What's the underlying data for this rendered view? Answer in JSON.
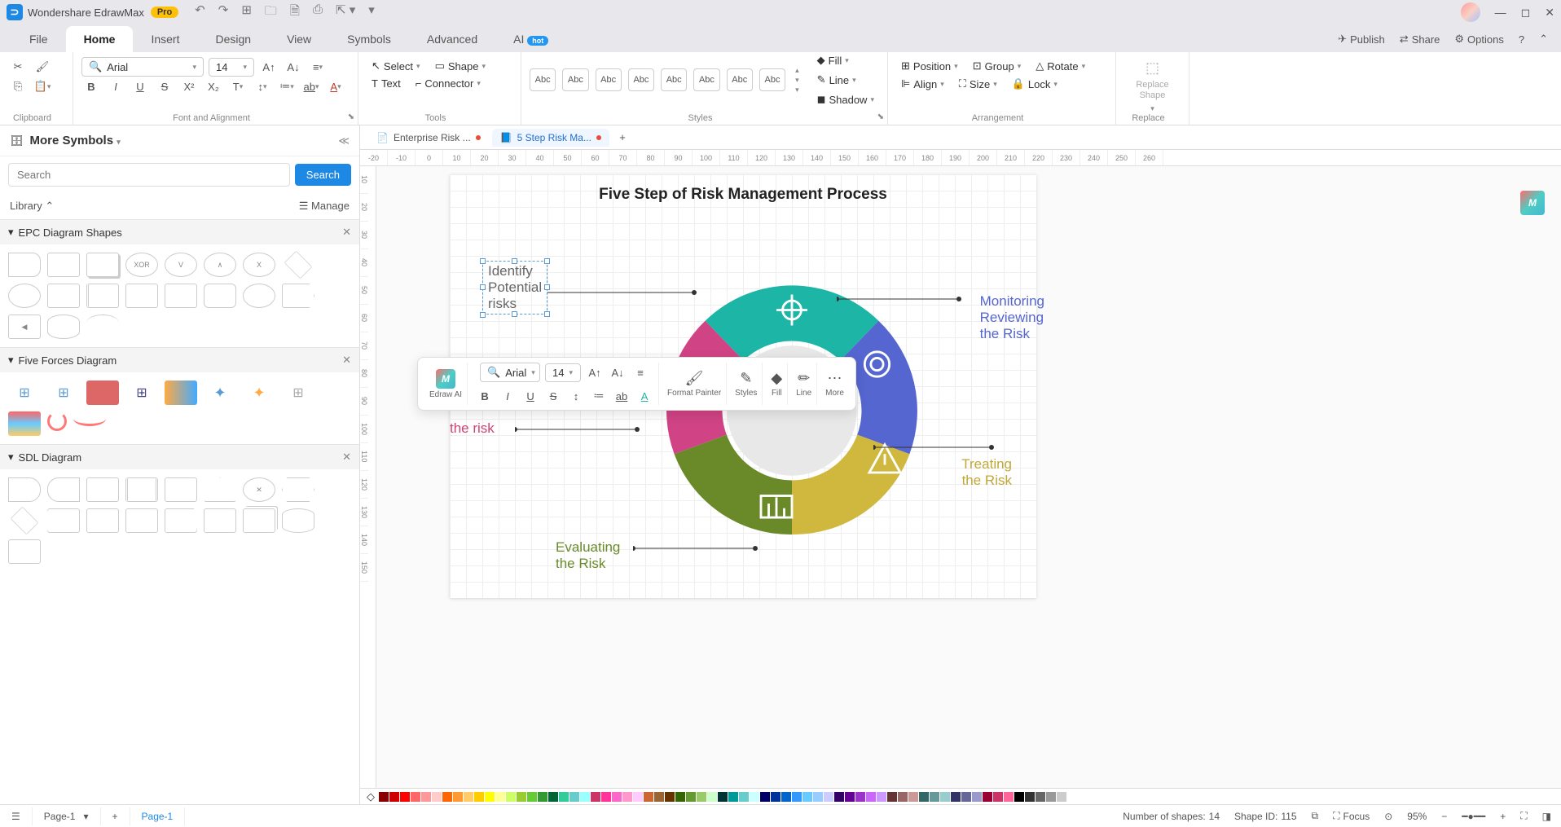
{
  "app": {
    "name": "Wondershare EdrawMax",
    "edition": "Pro"
  },
  "menubar": [
    "File",
    "Home",
    "Insert",
    "Design",
    "View",
    "Symbols",
    "Advanced",
    "AI"
  ],
  "menubar_active": 1,
  "topright": {
    "publish": "Publish",
    "share": "Share",
    "options": "Options"
  },
  "ribbon": {
    "clipboard": {
      "label": "Clipboard"
    },
    "font": {
      "label": "Font and Alignment",
      "family": "Arial",
      "size": "14"
    },
    "tools": {
      "label": "Tools",
      "select": "Select",
      "text": "Text",
      "shape": "Shape",
      "connector": "Connector"
    },
    "styles": {
      "label": "Styles",
      "swatch": "Abc",
      "fill": "Fill",
      "line": "Line",
      "shadow": "Shadow"
    },
    "arrange": {
      "label": "Arrangement",
      "position": "Position",
      "align": "Align",
      "group": "Group",
      "size": "Size",
      "rotate": "Rotate",
      "lock": "Lock"
    },
    "replace": {
      "label": "Replace",
      "btn": "Replace Shape"
    }
  },
  "left": {
    "title": "More Symbols",
    "search_placeholder": "Search",
    "search_btn": "Search",
    "library": "Library",
    "manage": "Manage",
    "cats": [
      "EPC Diagram Shapes",
      "Five Forces Diagram",
      "SDL Diagram"
    ],
    "xor": "XOR",
    "v": "V",
    "and": "∧",
    "x": "X"
  },
  "doctabs": [
    {
      "icon": "📄",
      "label": "Enterprise Risk ...",
      "dirty": true
    },
    {
      "icon": "📘",
      "label": "5 Step Risk Ma...",
      "dirty": true
    }
  ],
  "doctabs_active": 1,
  "ruler": [
    "-20",
    "-10",
    "0",
    "10",
    "20",
    "30",
    "40",
    "50",
    "60",
    "70",
    "80",
    "90",
    "100",
    "110",
    "120",
    "130",
    "140",
    "150",
    "160",
    "170",
    "180",
    "190",
    "200",
    "210",
    "220",
    "230",
    "240",
    "250",
    "260"
  ],
  "vruler": [
    "10",
    "20",
    "30",
    "40",
    "50",
    "60",
    "70",
    "80",
    "90",
    "100",
    "110",
    "120",
    "130",
    "140",
    "150"
  ],
  "diagram": {
    "title": "Five Step of Risk Management Process",
    "labels": {
      "identify": "Identify Potential risks",
      "monitor": "Monitoring\nReviewing\nthe Risk",
      "analyze": "the risk",
      "treat": "Treating\nthe Risk",
      "evaluate": "Evaluating\nthe Risk"
    },
    "colors": {
      "teal": "#1db5a6",
      "blue": "#5566d0",
      "yellow": "#d0b83e",
      "green": "#6a8a2a",
      "pink": "#d04384"
    }
  },
  "float": {
    "ai": "Edraw AI",
    "font": "Arial",
    "size": "14",
    "format_painter": "Format Painter",
    "styles": "Styles",
    "fill": "Fill",
    "line": "Line",
    "more": "More"
  },
  "palette": [
    "#880000",
    "#CC0000",
    "#FF0000",
    "#FF6666",
    "#FF9999",
    "#FFCCCC",
    "#FF6600",
    "#FF9933",
    "#FFCC66",
    "#FFCC00",
    "#FFFF00",
    "#FFFF99",
    "#CCFF66",
    "#99CC33",
    "#66CC33",
    "#339933",
    "#006633",
    "#33CC99",
    "#66CCCC",
    "#99FFFF",
    "#CC3366",
    "#FF3399",
    "#FF66CC",
    "#FF99CC",
    "#FFCCFF",
    "#CC6633",
    "#996633",
    "#663300",
    "#336600",
    "#669933",
    "#99CC66",
    "#CCFFCC",
    "#003333",
    "#009999",
    "#66CCCC",
    "#CCFFFF",
    "#000066",
    "#003399",
    "#0066CC",
    "#3399FF",
    "#66CCFF",
    "#99CCFF",
    "#CCCCFF",
    "#330066",
    "#660099",
    "#9933CC",
    "#CC66FF",
    "#CC99FF",
    "#663333",
    "#996666",
    "#CC9999",
    "#336666",
    "#669999",
    "#99CCCC",
    "#333366",
    "#666699",
    "#9999CC",
    "#990033",
    "#CC3366",
    "#FF6699",
    "#000000",
    "#333333",
    "#666666",
    "#999999",
    "#CCCCCC",
    "#FFFFFF"
  ],
  "bottombar": {
    "page_sel": "Page-1",
    "page_tab": "Page-1"
  },
  "status": {
    "shapes_lbl": "Number of shapes:",
    "shapes": "14",
    "shapeid_lbl": "Shape ID:",
    "shapeid": "115",
    "focus": "Focus",
    "zoom": "95%"
  }
}
